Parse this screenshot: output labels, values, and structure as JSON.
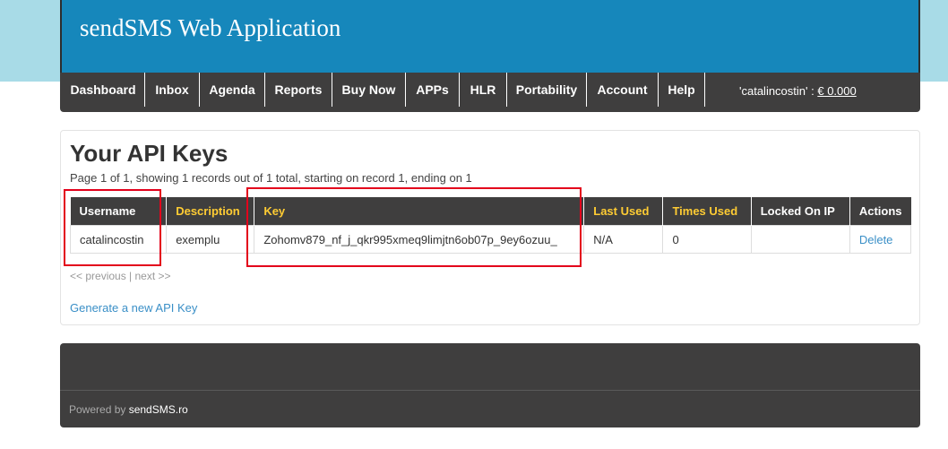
{
  "header": {
    "title": "sendSMS Web Application"
  },
  "nav": {
    "items": [
      {
        "label": "Dashboard"
      },
      {
        "label": "Inbox"
      },
      {
        "label": "Agenda"
      },
      {
        "label": "Reports"
      },
      {
        "label": "Buy Now"
      },
      {
        "label": "APPs"
      },
      {
        "label": "HLR"
      },
      {
        "label": "Portability"
      },
      {
        "label": "Account"
      },
      {
        "label": "Help"
      }
    ],
    "account": {
      "username": "'catalincostin'",
      "separator": " : ",
      "balance": "€ 0.000"
    }
  },
  "main": {
    "title": "Your API Keys",
    "summary": "Page 1 of 1, showing 1 records out of 1 total, starting on record 1, ending on 1",
    "table": {
      "headers": [
        "Username",
        "Description",
        "Key",
        "Last Used",
        "Times Used",
        "Locked On IP",
        "Actions"
      ],
      "rows": [
        {
          "username": "catalincostin",
          "description": "exemplu",
          "key": "Zohomv879_nf_j_qkr995xmeq9limjtn6ob07p_9ey6ozuu_",
          "last_used": "N/A",
          "times_used": "0",
          "locked_on_ip": "",
          "action": "Delete"
        }
      ]
    },
    "pager": "<< previous | next >>",
    "generate_link": "Generate a new API Key"
  },
  "footer": {
    "powered_prefix": "Powered by ",
    "brand": "sendSMS.ro"
  },
  "colors": {
    "header_bg": "#1687bb",
    "nav_bg": "#3f3e3e",
    "highlight_header_text": "#ffcc33",
    "link": "#3a8fc7",
    "annotation": "#e3001b"
  }
}
